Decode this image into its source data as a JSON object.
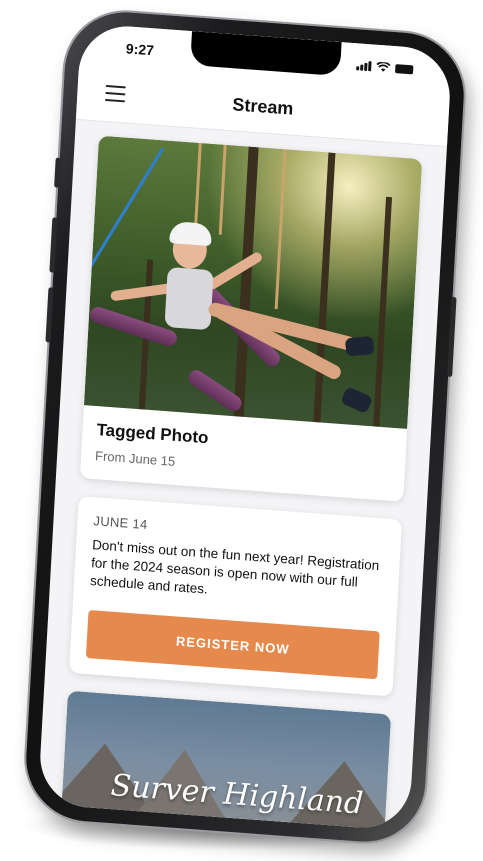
{
  "status_bar": {
    "time": "9:27"
  },
  "header": {
    "title": "Stream",
    "menu_icon": "hamburger-menu-icon"
  },
  "tagged_photo_card": {
    "title": "Tagged Photo",
    "subtitle": "From June 15"
  },
  "post_card": {
    "date": "JUNE 14",
    "text": "Don't miss out on the fun next year! Registration for the 2024 season is open now with our full schedule and rates.",
    "button_label": "REGISTER NOW"
  },
  "banner_card": {
    "title": "Surver Highland"
  },
  "colors": {
    "accent": "#e58a4c",
    "background": "#f4f4f6",
    "card": "#ffffff"
  }
}
